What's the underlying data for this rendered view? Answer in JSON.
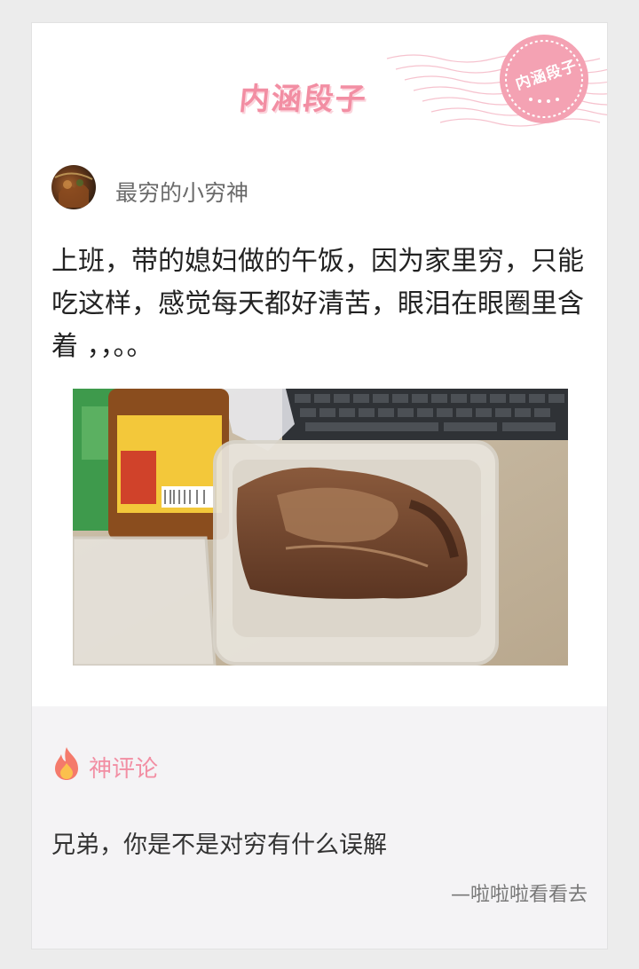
{
  "header": {
    "brand": "内涵段子",
    "stamp_text": "内涵段子",
    "accent_color": "#f28ea3"
  },
  "post": {
    "author_name": "最穷的小穷神",
    "avatar_icon": "avatar-image",
    "text": "上班，带的媳妇做的午饭，因为家里穷，只能吃这样，感觉每天都好清苦，眼泪在眼圈里含着 ，，。。",
    "image_description_icon": "photo-food-box"
  },
  "comments": {
    "section_label": "神评论",
    "icon": "fire-icon",
    "text": "兄弟，你是不是对穷有什么误解",
    "signature": "—啦啦啦看看去"
  }
}
